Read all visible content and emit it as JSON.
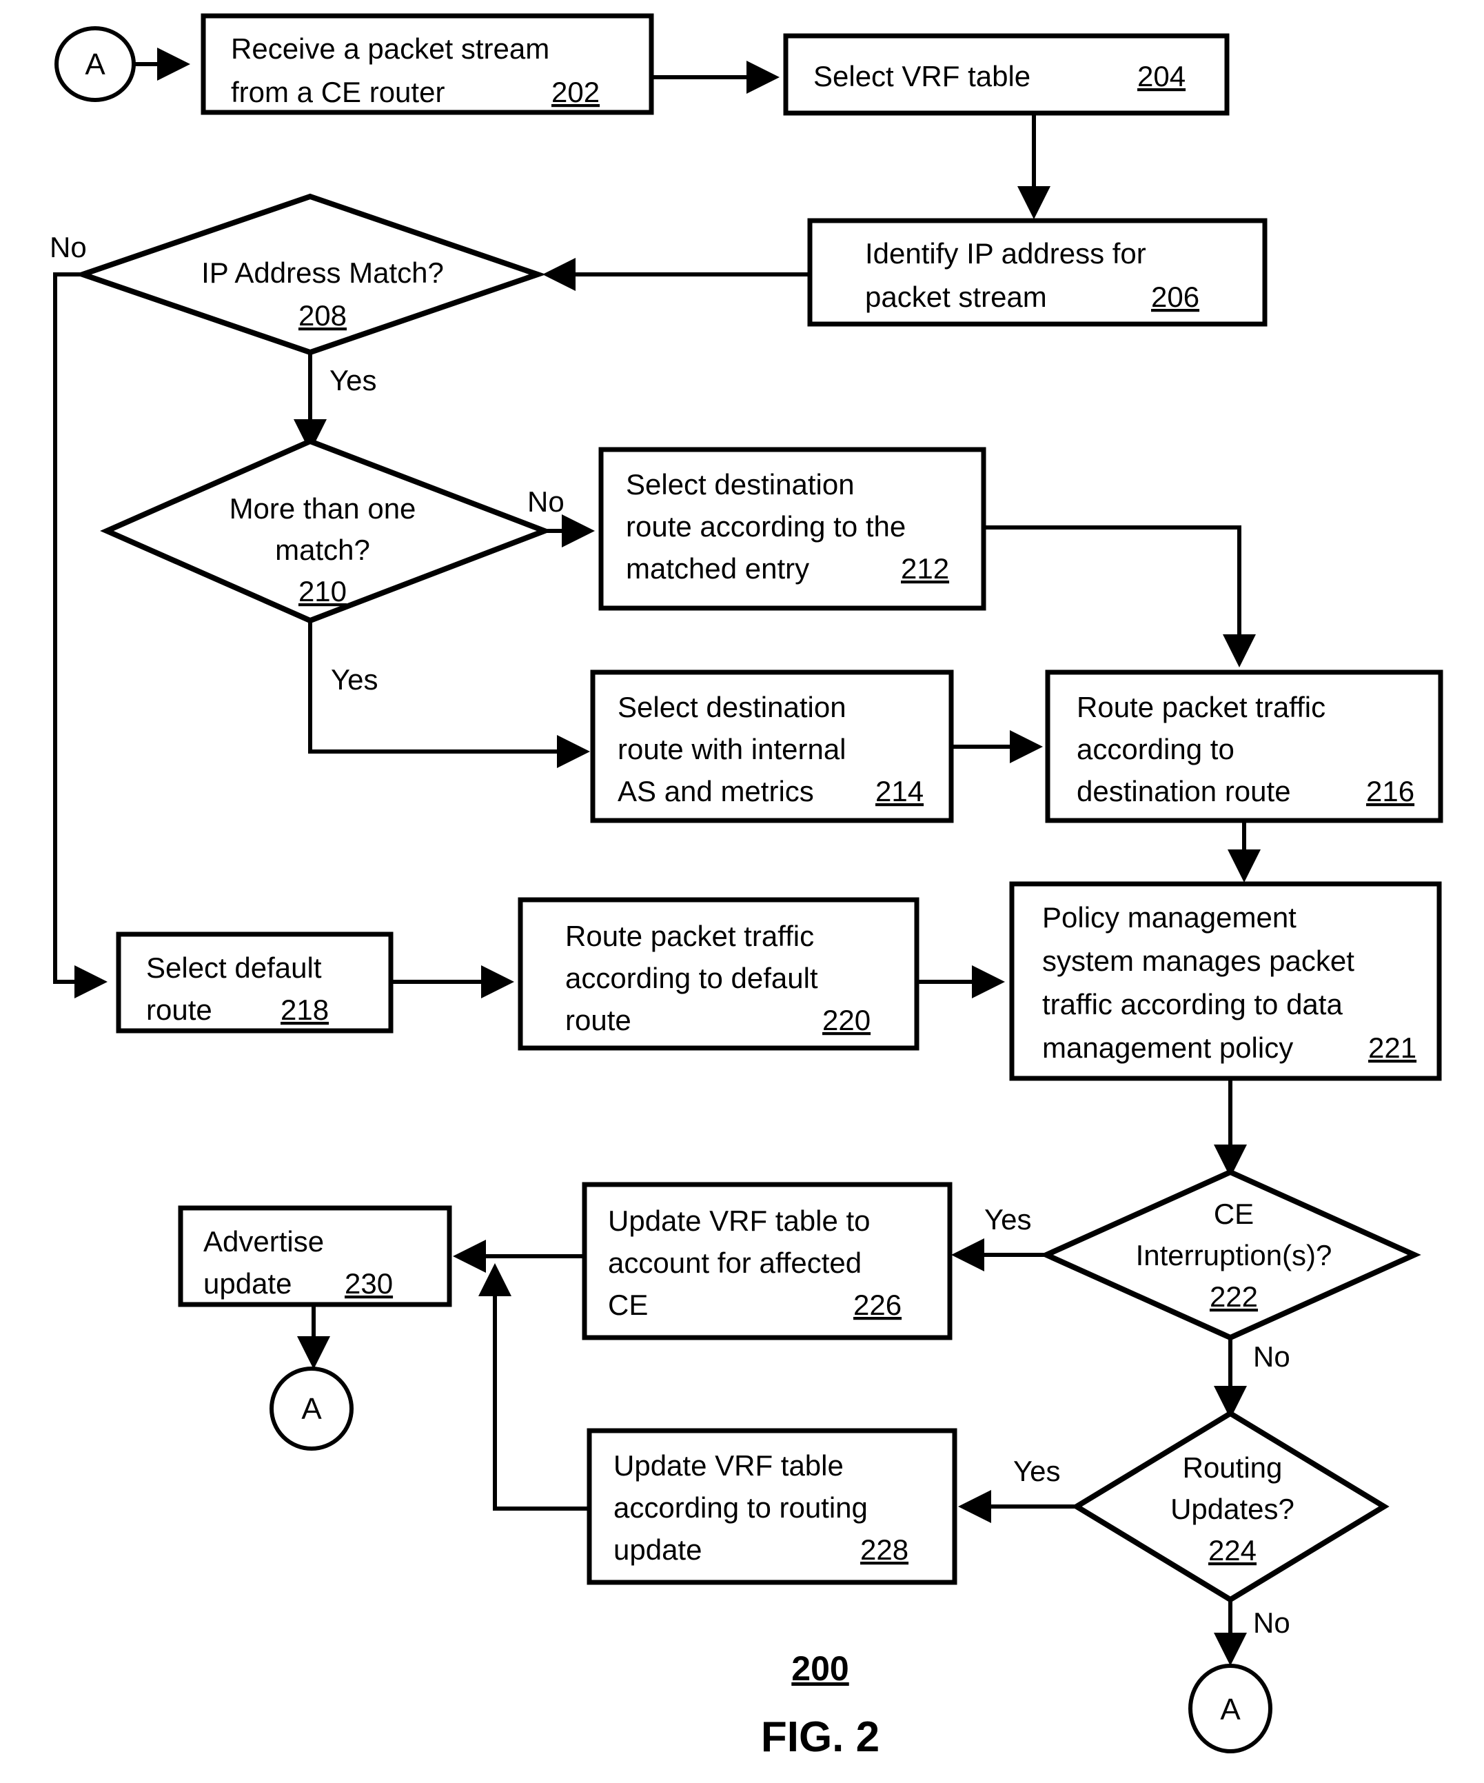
{
  "figure": {
    "number_label": "200",
    "caption": "FIG. 2"
  },
  "connectors": {
    "entry_letter": "A",
    "exit_advertise_letter": "A",
    "exit_routing_letter": "A"
  },
  "nodes": [
    {
      "id": "202",
      "shape": "box",
      "lines": [
        "Receive a packet stream",
        "from a CE router"
      ],
      "ref": "202"
    },
    {
      "id": "204",
      "shape": "box",
      "lines": [
        "Select VRF table"
      ],
      "ref": "204"
    },
    {
      "id": "206",
      "shape": "box",
      "lines": [
        "Identify IP address for",
        "packet stream"
      ],
      "ref": "206"
    },
    {
      "id": "208",
      "shape": "diamond",
      "lines": [
        "IP Address Match?"
      ],
      "ref": "208"
    },
    {
      "id": "210",
      "shape": "diamond",
      "lines": [
        "More than one",
        "match?"
      ],
      "ref": "210"
    },
    {
      "id": "212",
      "shape": "box",
      "lines": [
        "Select destination",
        "route according to the",
        "matched entry"
      ],
      "ref": "212"
    },
    {
      "id": "214",
      "shape": "box",
      "lines": [
        "Select destination",
        "route with internal",
        "AS and metrics"
      ],
      "ref": "214"
    },
    {
      "id": "216",
      "shape": "box",
      "lines": [
        "Route packet traffic",
        "according to",
        "destination route"
      ],
      "ref": "216"
    },
    {
      "id": "218",
      "shape": "box",
      "lines": [
        "Select default",
        "route"
      ],
      "ref": "218"
    },
    {
      "id": "220",
      "shape": "box",
      "lines": [
        "Route packet traffic",
        "according to default",
        "route"
      ],
      "ref": "220"
    },
    {
      "id": "221",
      "shape": "box",
      "lines": [
        "Policy management",
        "system manages packet",
        "traffic according to data",
        "management policy"
      ],
      "ref": "221"
    },
    {
      "id": "222",
      "shape": "diamond",
      "lines": [
        "CE",
        "Interruption(s)?"
      ],
      "ref": "222"
    },
    {
      "id": "224",
      "shape": "diamond",
      "lines": [
        "Routing",
        "Updates?"
      ],
      "ref": "224"
    },
    {
      "id": "226",
      "shape": "box",
      "lines": [
        "Update VRF table to",
        "account for affected",
        "CE"
      ],
      "ref": "226"
    },
    {
      "id": "228",
      "shape": "box",
      "lines": [
        "Update VRF table",
        "according to routing",
        "update"
      ],
      "ref": "228"
    },
    {
      "id": "230",
      "shape": "box",
      "lines": [
        "Advertise",
        "update"
      ],
      "ref": "230"
    }
  ],
  "text": {
    "n202_l1": "Receive a packet stream",
    "n202_l2": "from a CE router",
    "n202_ref": "202",
    "n204_l1": "Select VRF table",
    "n204_ref": "204",
    "n206_l1": "Identify IP address for",
    "n206_l2": "packet stream",
    "n206_ref": "206",
    "n208_l1": "IP Address Match?",
    "n208_ref": "208",
    "n210_l1": "More than one",
    "n210_l2": "match?",
    "n210_ref": "210",
    "n212_l1": "Select destination",
    "n212_l2": "route according to the",
    "n212_l3": "matched entry",
    "n212_ref": "212",
    "n214_l1": "Select destination",
    "n214_l2": "route with internal",
    "n214_l3": "AS and metrics",
    "n214_ref": "214",
    "n216_l1": "Route packet traffic",
    "n216_l2": "according to",
    "n216_l3": "destination route",
    "n216_ref": "216",
    "n218_l1": "Select default",
    "n218_l2": "route",
    "n218_ref": "218",
    "n220_l1": "Route packet traffic",
    "n220_l2": "according to default",
    "n220_l3": "route",
    "n220_ref": "220",
    "n221_l1": "Policy management",
    "n221_l2": "system manages packet",
    "n221_l3": "traffic according to data",
    "n221_l4": "management policy",
    "n221_ref": "221",
    "n222_l1": "CE",
    "n222_l2": "Interruption(s)?",
    "n222_ref": "222",
    "n224_l1": "Routing",
    "n224_l2": "Updates?",
    "n224_ref": "224",
    "n226_l1": "Update VRF table to",
    "n226_l2": "account for affected",
    "n226_l3": "CE",
    "n226_ref": "226",
    "n228_l1": "Update VRF table",
    "n228_l2": "according to routing",
    "n228_l3": "update",
    "n228_ref": "228",
    "n230_l1": "Advertise",
    "n230_l2": "update",
    "n230_ref": "230"
  },
  "edge_labels": {
    "e208_no": "No",
    "e208_yes": "Yes",
    "e210_no": "No",
    "e210_yes": "Yes",
    "e222_yes": "Yes",
    "e222_no": "No",
    "e224_yes": "Yes",
    "e224_no": "No"
  },
  "colors": {
    "stroke": "#000000",
    "fill": "#ffffff"
  }
}
